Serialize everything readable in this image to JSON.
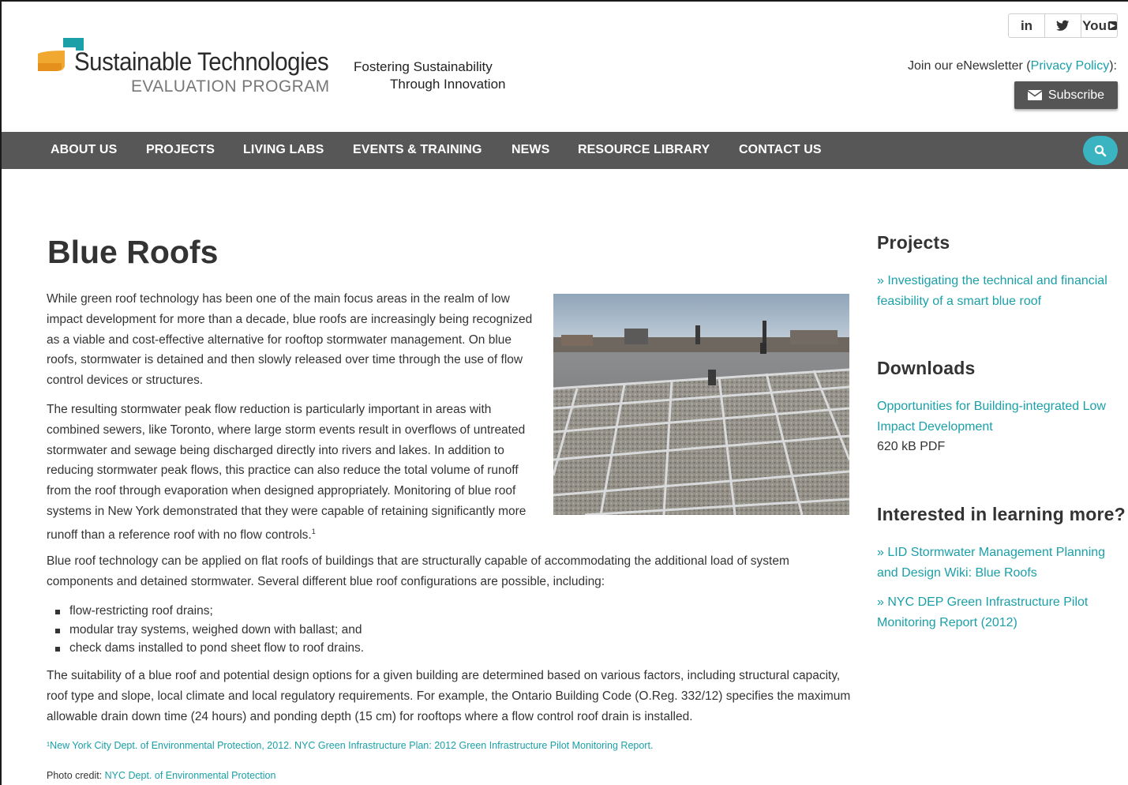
{
  "header": {
    "logo_title": "Sustainable Technologies",
    "logo_subtitle": "EVALUATION PROGRAM",
    "tagline_line1": "Fostering Sustainability",
    "tagline_line2": "Through Innovation",
    "social": [
      {
        "label": "in",
        "icon": "linkedin-icon"
      },
      {
        "label": "🐦",
        "icon": "twitter-icon"
      },
      {
        "label": "You",
        "icon": "youtube-icon"
      }
    ],
    "newsletter_prefix": "Join our eNewsletter (",
    "newsletter_link": "Privacy Policy",
    "newsletter_suffix": "):",
    "subscribe_label": "Subscribe"
  },
  "nav": {
    "items": [
      "ABOUT US",
      "PROJECTS",
      "LIVING LABS",
      "EVENTS & TRAINING",
      "NEWS",
      "RESOURCE LIBRARY",
      "CONTACT US"
    ]
  },
  "main": {
    "title": "Blue Roofs",
    "p1": "While green roof technology has been one of the main focus areas in the realm of low impact development for more than a decade, blue roofs are increasingly being recognized as a viable and cost-effective alternative for rooftop stormwater management.  On blue roofs, stormwater is detained and then slowly released over time through the use of flow control devices or structures.",
    "p2": "The resulting stormwater peak flow reduction is particularly important in areas with combined sewers, like Toronto, where large storm events result in overflows of untreated stormwater and sewage being discharged directly into rivers and lakes. In addition to reducing stormwater peak flows, this practice can also reduce the total volume of runoff from the roof through evaporation when designed appropriately. Monitoring of blue roof systems in New York demonstrated that they were capable of retaining significantly more runoff than a reference roof with no flow controls.",
    "p2_sup": "1",
    "p3": "Blue roof technology can be applied on flat roofs of buildings that are structurally capable of accommodating the additional load of system components and detained stormwater.  Several different blue roof configurations are possible, including:",
    "bullets": [
      "flow-restricting roof drains;",
      "modular tray systems, weighed down with ballast; and",
      "check dams installed to pond sheet flow to roof drains."
    ],
    "p4": "The suitability of a blue roof and potential design options for a given building are determined based on various factors, including structural capacity, roof type and slope, local climate and local regulatory requirements.  For example, the Ontario Building Code (O.Reg. 332/12) specifies the maximum allowable drain down time (24 hours) and ponding depth (15 cm) for rooftops where a flow control roof drain is installed.",
    "footnote": "¹New York City Dept. of Environmental  Protection, 2012.  NYC Green Infrastructure Plan: 2012 Green Infrastructure Pilot Monitoring Report.",
    "credit_label": "Photo credit: ",
    "credit_link": "NYC Dept. of Environmental Protection"
  },
  "sidebar": {
    "projects_heading": "Projects",
    "projects_link": "» Investigating the technical and financial feasibility of a smart blue roof",
    "downloads_heading": "Downloads",
    "download_link": "Opportunities for Building-integrated Low Impact Development",
    "download_meta": "620 kB PDF",
    "more_heading": "Interested in learning more?",
    "more_links": [
      "» LID Stormwater Management Planning and Design Wiki: Blue Roofs",
      "» NYC DEP Green Infrastructure Pilot Monitoring Report (2012)"
    ]
  },
  "colors": {
    "accent": "#1ba0a8",
    "nav_bg": "#575757",
    "search_btn": "#3ab4c0",
    "logo_orange": "#f0a830",
    "logo_teal": "#1ba0a8"
  }
}
